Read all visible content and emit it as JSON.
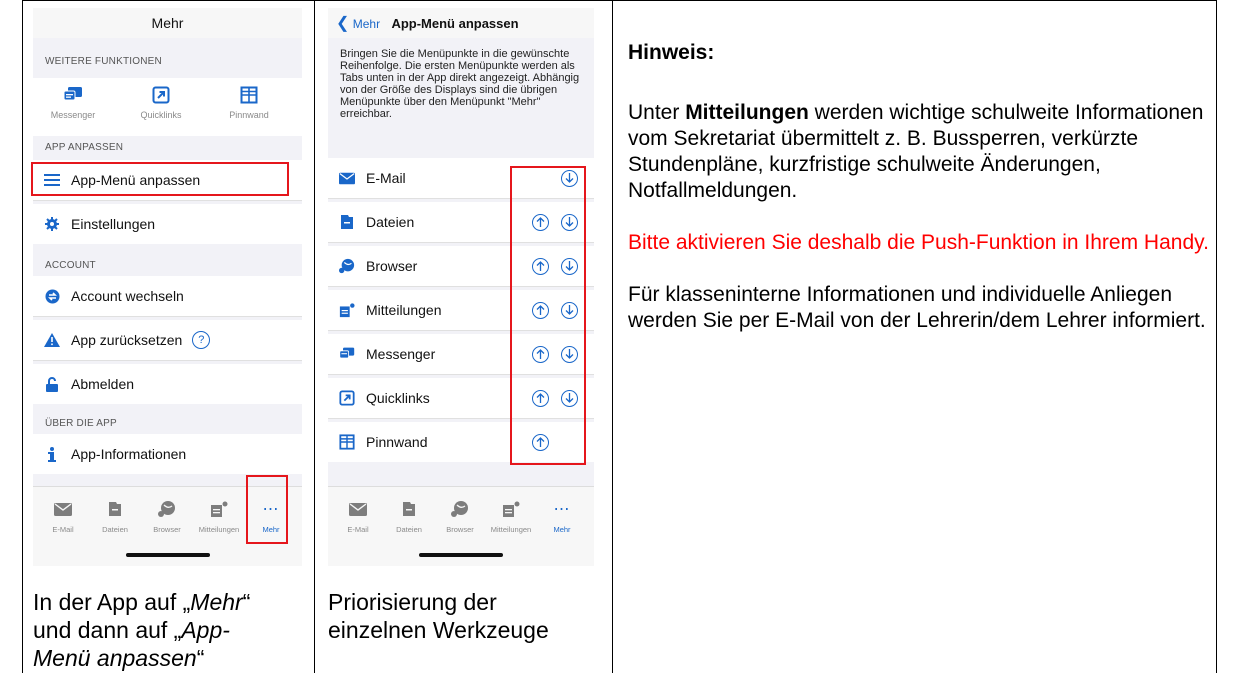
{
  "phone1": {
    "title": "Mehr",
    "sections": {
      "further": "WEITERE FUNKTIONEN",
      "customize": "APP ANPASSEN",
      "account": "ACCOUNT",
      "about": "ÜBER DIE APP"
    },
    "quicklinks": [
      "Messenger",
      "Quicklinks",
      "Pinnwand"
    ],
    "rows": {
      "menu": "App-Menü anpassen",
      "settings": "Einstellungen",
      "switch_account": "Account wechseln",
      "reset": "App zurücksetzen",
      "logout": "Abmelden",
      "info": "App-Informationen"
    },
    "tabs": [
      "E-Mail",
      "Dateien",
      "Browser",
      "Mitteilungen",
      "Mehr"
    ]
  },
  "phone2": {
    "back_label": "Mehr",
    "title": "App-Menü anpassen",
    "description": "Bringen Sie die Menüpunkte in die gewünschte Reihenfolge. Die ersten Menüpunkte werden als Tabs unten in der App direkt angezeigt. Abhängig von der Größe des Displays sind die übrigen Menüpunkte über den Menüpunkt \"Mehr\" erreichbar.",
    "items": [
      "E-Mail",
      "Dateien",
      "Browser",
      "Mitteilungen",
      "Messenger",
      "Quicklinks",
      "Pinnwand"
    ],
    "tabs": [
      "E-Mail",
      "Dateien",
      "Browser",
      "Mitteilungen",
      "Mehr"
    ]
  },
  "captions": {
    "col1_a": "In der App auf „",
    "col1_b": "Mehr",
    "col1_c": "“",
    "col1_d": "und dann auf „",
    "col1_e": "App-",
    "col1_f": "Menü anpassen",
    "col1_g": "“",
    "col2_line1": "Priorisierung der",
    "col2_line2": "einzelnen Werkzeuge"
  },
  "note": {
    "heading": "Hinweis:",
    "p1_before": "Unter ",
    "p1_bold": "Mitteilungen",
    "p1_after": " werden wichtige schulweite Informationen vom Sekretariat übermittelt z. B. Bussperren, verkürzte Stundenpläne, kurzfristige schulweite Änderungen, Notfallmeldungen.",
    "p2": "Bitte aktivieren Sie deshalb die Push-Funktion in Ihrem Handy.",
    "p3": "Für klasseninterne Informationen und individuelle Anliegen werden Sie per E-Mail von der Lehrerin/dem Lehrer informiert."
  },
  "colors": {
    "accent_blue": "#1a67c9",
    "highlight_red": "#e5161c",
    "warning_red": "#ff0000"
  }
}
